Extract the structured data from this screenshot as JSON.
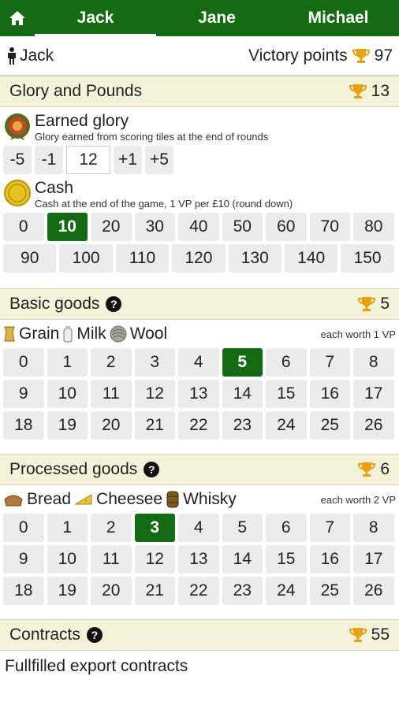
{
  "nav": {
    "home_icon": "home-icon",
    "tabs": [
      {
        "label": "Jack",
        "active": true
      },
      {
        "label": "Jane",
        "active": false
      },
      {
        "label": "Michael",
        "active": false
      }
    ]
  },
  "player": {
    "name": "Jack",
    "vp_label": "Victory points",
    "vp_value": "97"
  },
  "glory_section": {
    "title": "Glory and Pounds",
    "score": "13",
    "earned": {
      "title": "Earned glory",
      "subtitle": "Glory earned from scoring tiles at the end of rounds",
      "buttons": [
        "-5",
        "-1",
        "+1",
        "+5"
      ],
      "value": "12"
    },
    "cash": {
      "title": "Cash",
      "subtitle": "Cash at the end of the game, 1 VP per £10 (round down)",
      "row1": [
        "0",
        "10",
        "20",
        "30",
        "40",
        "50",
        "60",
        "70",
        "80"
      ],
      "row2": [
        "90",
        "100",
        "110",
        "120",
        "130",
        "140",
        "150"
      ],
      "selected": "10"
    }
  },
  "basic_section": {
    "title": "Basic goods",
    "score": "5",
    "goods": [
      "Grain",
      "Milk",
      "Wool"
    ],
    "each_worth": "each worth 1 VP",
    "selected": "5"
  },
  "processed_section": {
    "title": "Processed goods",
    "score": "6",
    "goods": [
      "Bread",
      "Cheesee",
      "Whisky"
    ],
    "each_worth": "each worth 2 VP",
    "selected": "3"
  },
  "contracts_section": {
    "title": "Contracts",
    "score": "55",
    "subtitle": "Fullfilled export contracts"
  },
  "colors": {
    "brand_green": "#146b14",
    "section_bg": "#f4f2d9",
    "trophy": "#e8a10f"
  }
}
